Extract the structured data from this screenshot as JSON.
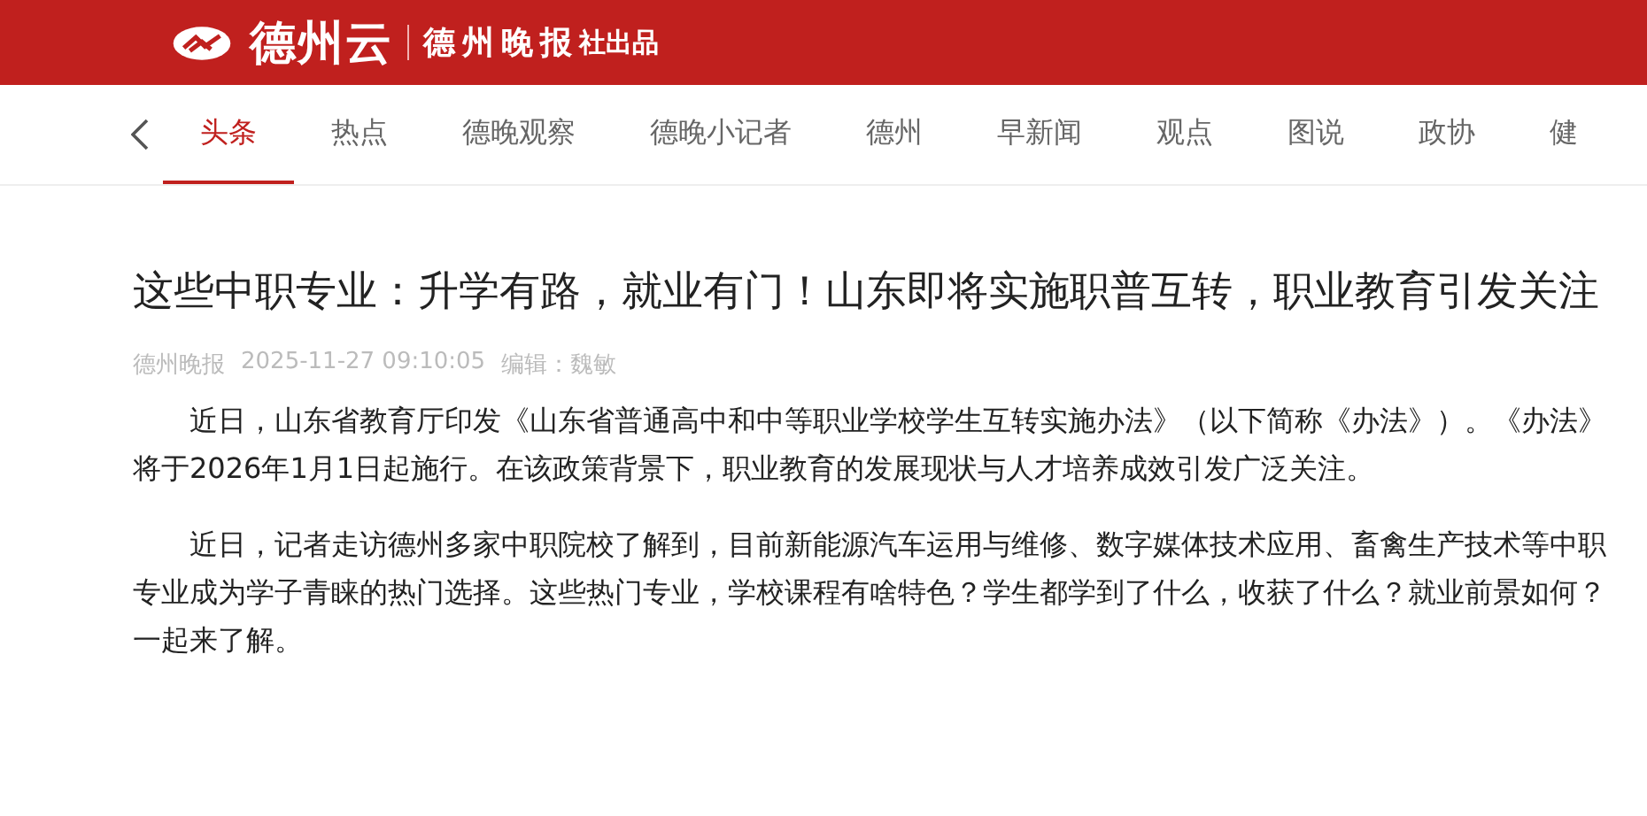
{
  "header": {
    "brand": "德州云",
    "publisher": "德州晚报",
    "publisher_suffix": "社出品"
  },
  "tabs": [
    {
      "label": "头条",
      "selected": true
    },
    {
      "label": "热点",
      "selected": false
    },
    {
      "label": "德晚观察",
      "selected": false
    },
    {
      "label": "德晚小记者",
      "selected": false
    },
    {
      "label": "德州",
      "selected": false
    },
    {
      "label": "早新闻",
      "selected": false
    },
    {
      "label": "观点",
      "selected": false
    },
    {
      "label": "图说",
      "selected": false
    },
    {
      "label": "政协",
      "selected": false
    },
    {
      "label": "健",
      "selected": false
    }
  ],
  "article": {
    "title": "这些中职专业：升学有路，就业有门！山东即将实施职普互转，职业教育引发关注",
    "source": "德州晚报",
    "time": "2025-11-27 09:10:05",
    "editor": "编辑：魏敏",
    "paragraphs": [
      "近日，山东省教育厅印发《山东省普通高中和中等职业学校学生互转实施办法》（以下简称《办法》）。《办法》将于2026年1月1日起施行。在该政策背景下，职业教育的发展现状与人才培养成效引发广泛关注。",
      "近日，记者走访德州多家中职院校了解到，目前新能源汽车运用与维修、数字媒体技术应用、畜禽生产技术等中职专业成为学子青睐的热门选择。这些热门专业，学校课程有啥特色？学生都学到了什么，收获了什么？就业前景如何？一起来了解。"
    ]
  }
}
